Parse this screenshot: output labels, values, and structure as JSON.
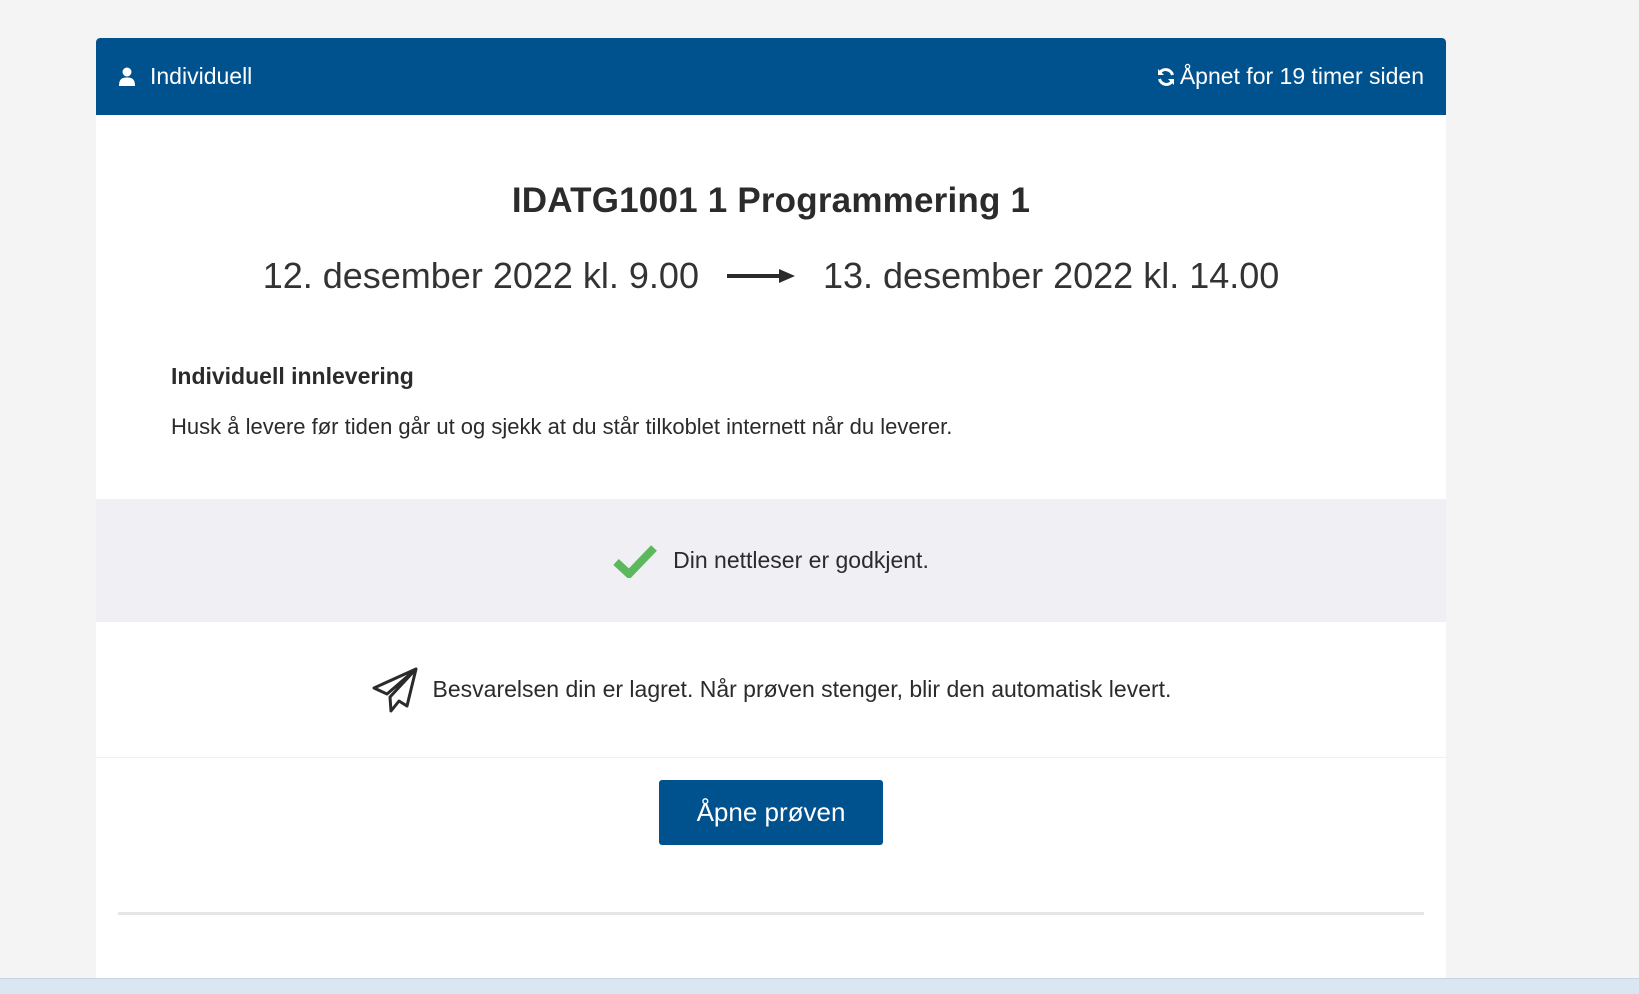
{
  "header": {
    "mode_icon": "user-icon",
    "mode_label": "Individuell",
    "status_icon": "refresh-icon",
    "status_label": "Åpnet for 19 timer siden",
    "bg_color": "#00528f"
  },
  "exam": {
    "title": "IDATG1001 1 Programmering 1",
    "start": "12. desember 2022 kl. 9.00",
    "end": "13. desember 2022 kl. 14.00",
    "arrow_icon": "arrow-right-icon"
  },
  "info": {
    "title": "Individuell innlevering",
    "text": "Husk å levere før tiden går ut og sjekk at du står tilkoblet internett når du leverer."
  },
  "browser_check": {
    "icon": "checkmark-icon",
    "text": "Din nettleser er godkjent.",
    "icon_color": "#5cb85c"
  },
  "submission": {
    "icon": "paper-plane-icon",
    "text": "Besvarelsen din er lagret. Når prøven stenger, blir den automatisk levert."
  },
  "actions": {
    "open_label": "Åpne prøven"
  }
}
